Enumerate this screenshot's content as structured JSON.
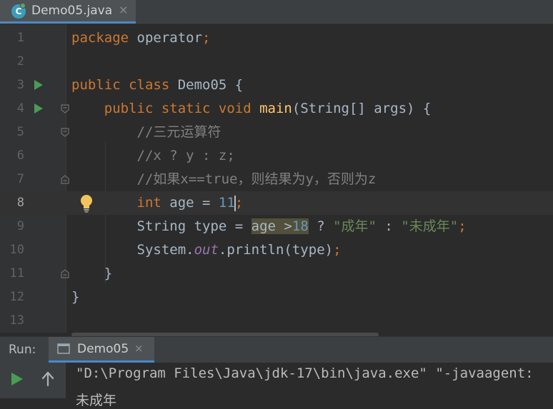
{
  "editor_tab": {
    "filename": "Demo05.java",
    "close": "×"
  },
  "code_lines": [
    {
      "num": "1",
      "segments": [
        {
          "cls": "kw",
          "t": "package "
        },
        {
          "cls": "",
          "t": "operator"
        },
        {
          "cls": "kw",
          "t": ";"
        }
      ]
    },
    {
      "num": "2",
      "segments": []
    },
    {
      "num": "3",
      "segments": [
        {
          "cls": "kw",
          "t": "public class "
        },
        {
          "cls": "",
          "t": "Demo05 {"
        }
      ]
    },
    {
      "num": "4",
      "segments": [
        {
          "cls": "",
          "t": "    "
        },
        {
          "cls": "kw",
          "t": "public static void "
        },
        {
          "cls": "fn",
          "t": "main"
        },
        {
          "cls": "",
          "t": "(String[] args) {"
        }
      ]
    },
    {
      "num": "5",
      "segments": [
        {
          "cls": "",
          "t": "        "
        },
        {
          "cls": "cmt",
          "t": "//三元运算符"
        }
      ]
    },
    {
      "num": "6",
      "segments": [
        {
          "cls": "",
          "t": "        "
        },
        {
          "cls": "cmt",
          "t": "//x ? y : z;"
        }
      ]
    },
    {
      "num": "7",
      "segments": [
        {
          "cls": "",
          "t": "        "
        },
        {
          "cls": "cmt",
          "t": "//如果x==true，则结果为y，否则为z"
        }
      ]
    },
    {
      "num": "8",
      "segments": [
        {
          "cls": "",
          "t": "        "
        },
        {
          "cls": "kw",
          "t": "int "
        },
        {
          "cls": "",
          "t": "age = "
        },
        {
          "cls": "num",
          "t": "11"
        },
        {
          "cls": "caret",
          "t": ""
        },
        {
          "cls": "kw",
          "t": ";"
        }
      ]
    },
    {
      "num": "9",
      "segments": [
        {
          "cls": "",
          "t": "        String type = "
        },
        {
          "cls": "hl",
          "t": "age >"
        },
        {
          "cls": "num hl",
          "t": "18"
        },
        {
          "cls": "",
          "t": " ? "
        },
        {
          "cls": "str",
          "t": "\"成年\""
        },
        {
          "cls": "",
          "t": " : "
        },
        {
          "cls": "str",
          "t": "\"未成年\""
        },
        {
          "cls": "kw",
          "t": ";"
        }
      ]
    },
    {
      "num": "10",
      "segments": [
        {
          "cls": "",
          "t": "        System."
        },
        {
          "cls": "stat",
          "t": "out"
        },
        {
          "cls": "",
          "t": ".println(type)"
        },
        {
          "cls": "kw",
          "t": ";"
        }
      ]
    },
    {
      "num": "11",
      "segments": [
        {
          "cls": "",
          "t": "    }"
        }
      ]
    },
    {
      "num": "12",
      "segments": [
        {
          "cls": "",
          "t": "}"
        }
      ]
    },
    {
      "num": "13",
      "segments": []
    }
  ],
  "run_panel": {
    "label": "Run:",
    "tab_name": "Demo05",
    "tab_close": "×",
    "console_lines": [
      "\"D:\\Program Files\\Java\\jdk-17\\bin\\java.exe\" \"-javaagent:",
      "未成年"
    ]
  },
  "colors": {
    "keyword": "#cc7832",
    "method": "#ffc66d",
    "number": "#6897bb",
    "string": "#6a8759",
    "comment": "#808080",
    "static_field": "#9876aa",
    "run_green": "#499c54"
  },
  "icons": {
    "file_icon": "java-class-icon",
    "run_gutter": "run-arrow-icon",
    "fold": "fold-marker-icon",
    "intention": "lightbulb-icon",
    "rerun": "rerun-icon",
    "scroll_up": "up-arrow-icon",
    "console_tab": "console-icon"
  }
}
